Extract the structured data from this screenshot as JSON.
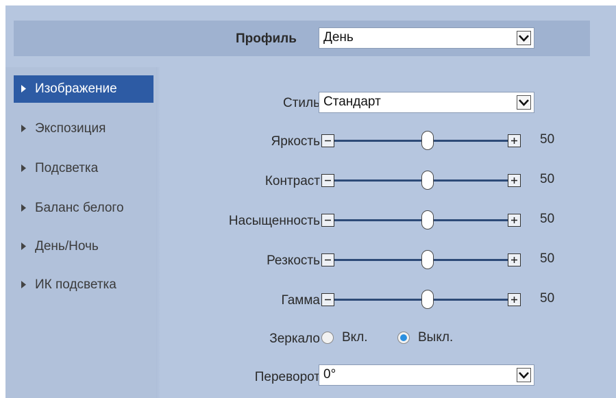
{
  "header": {
    "profile_label": "Профиль",
    "profile_value": "День"
  },
  "sidebar": {
    "items": [
      {
        "label": "Изображение",
        "active": true
      },
      {
        "label": "Экспозиция",
        "active": false
      },
      {
        "label": "Подсветка",
        "active": false
      },
      {
        "label": "Баланс белого",
        "active": false
      },
      {
        "label": "День/Ночь",
        "active": false
      },
      {
        "label": "ИК подсветка",
        "active": false
      }
    ]
  },
  "settings": {
    "style_label": "Стиль",
    "style_value": "Стандарт",
    "brightness_label": "Яркость",
    "brightness_value": "50",
    "contrast_label": "Контраст",
    "contrast_value": "50",
    "saturation_label": "Насыщенность",
    "saturation_value": "50",
    "sharpness_label": "Резкость",
    "sharpness_value": "50",
    "gamma_label": "Гамма",
    "gamma_value": "50",
    "mirror_label": "Зеркало",
    "mirror_on_label": "Вкл.",
    "mirror_off_label": "Выкл.",
    "mirror_selected": "Выкл.",
    "flip_label": "Переворот",
    "flip_value": "0°"
  },
  "colors": {
    "panel": "#b6c6df",
    "header_bar": "#9fb2d0",
    "active_nav": "#2d5ba4",
    "radio_selected": "#2a8fe0"
  }
}
